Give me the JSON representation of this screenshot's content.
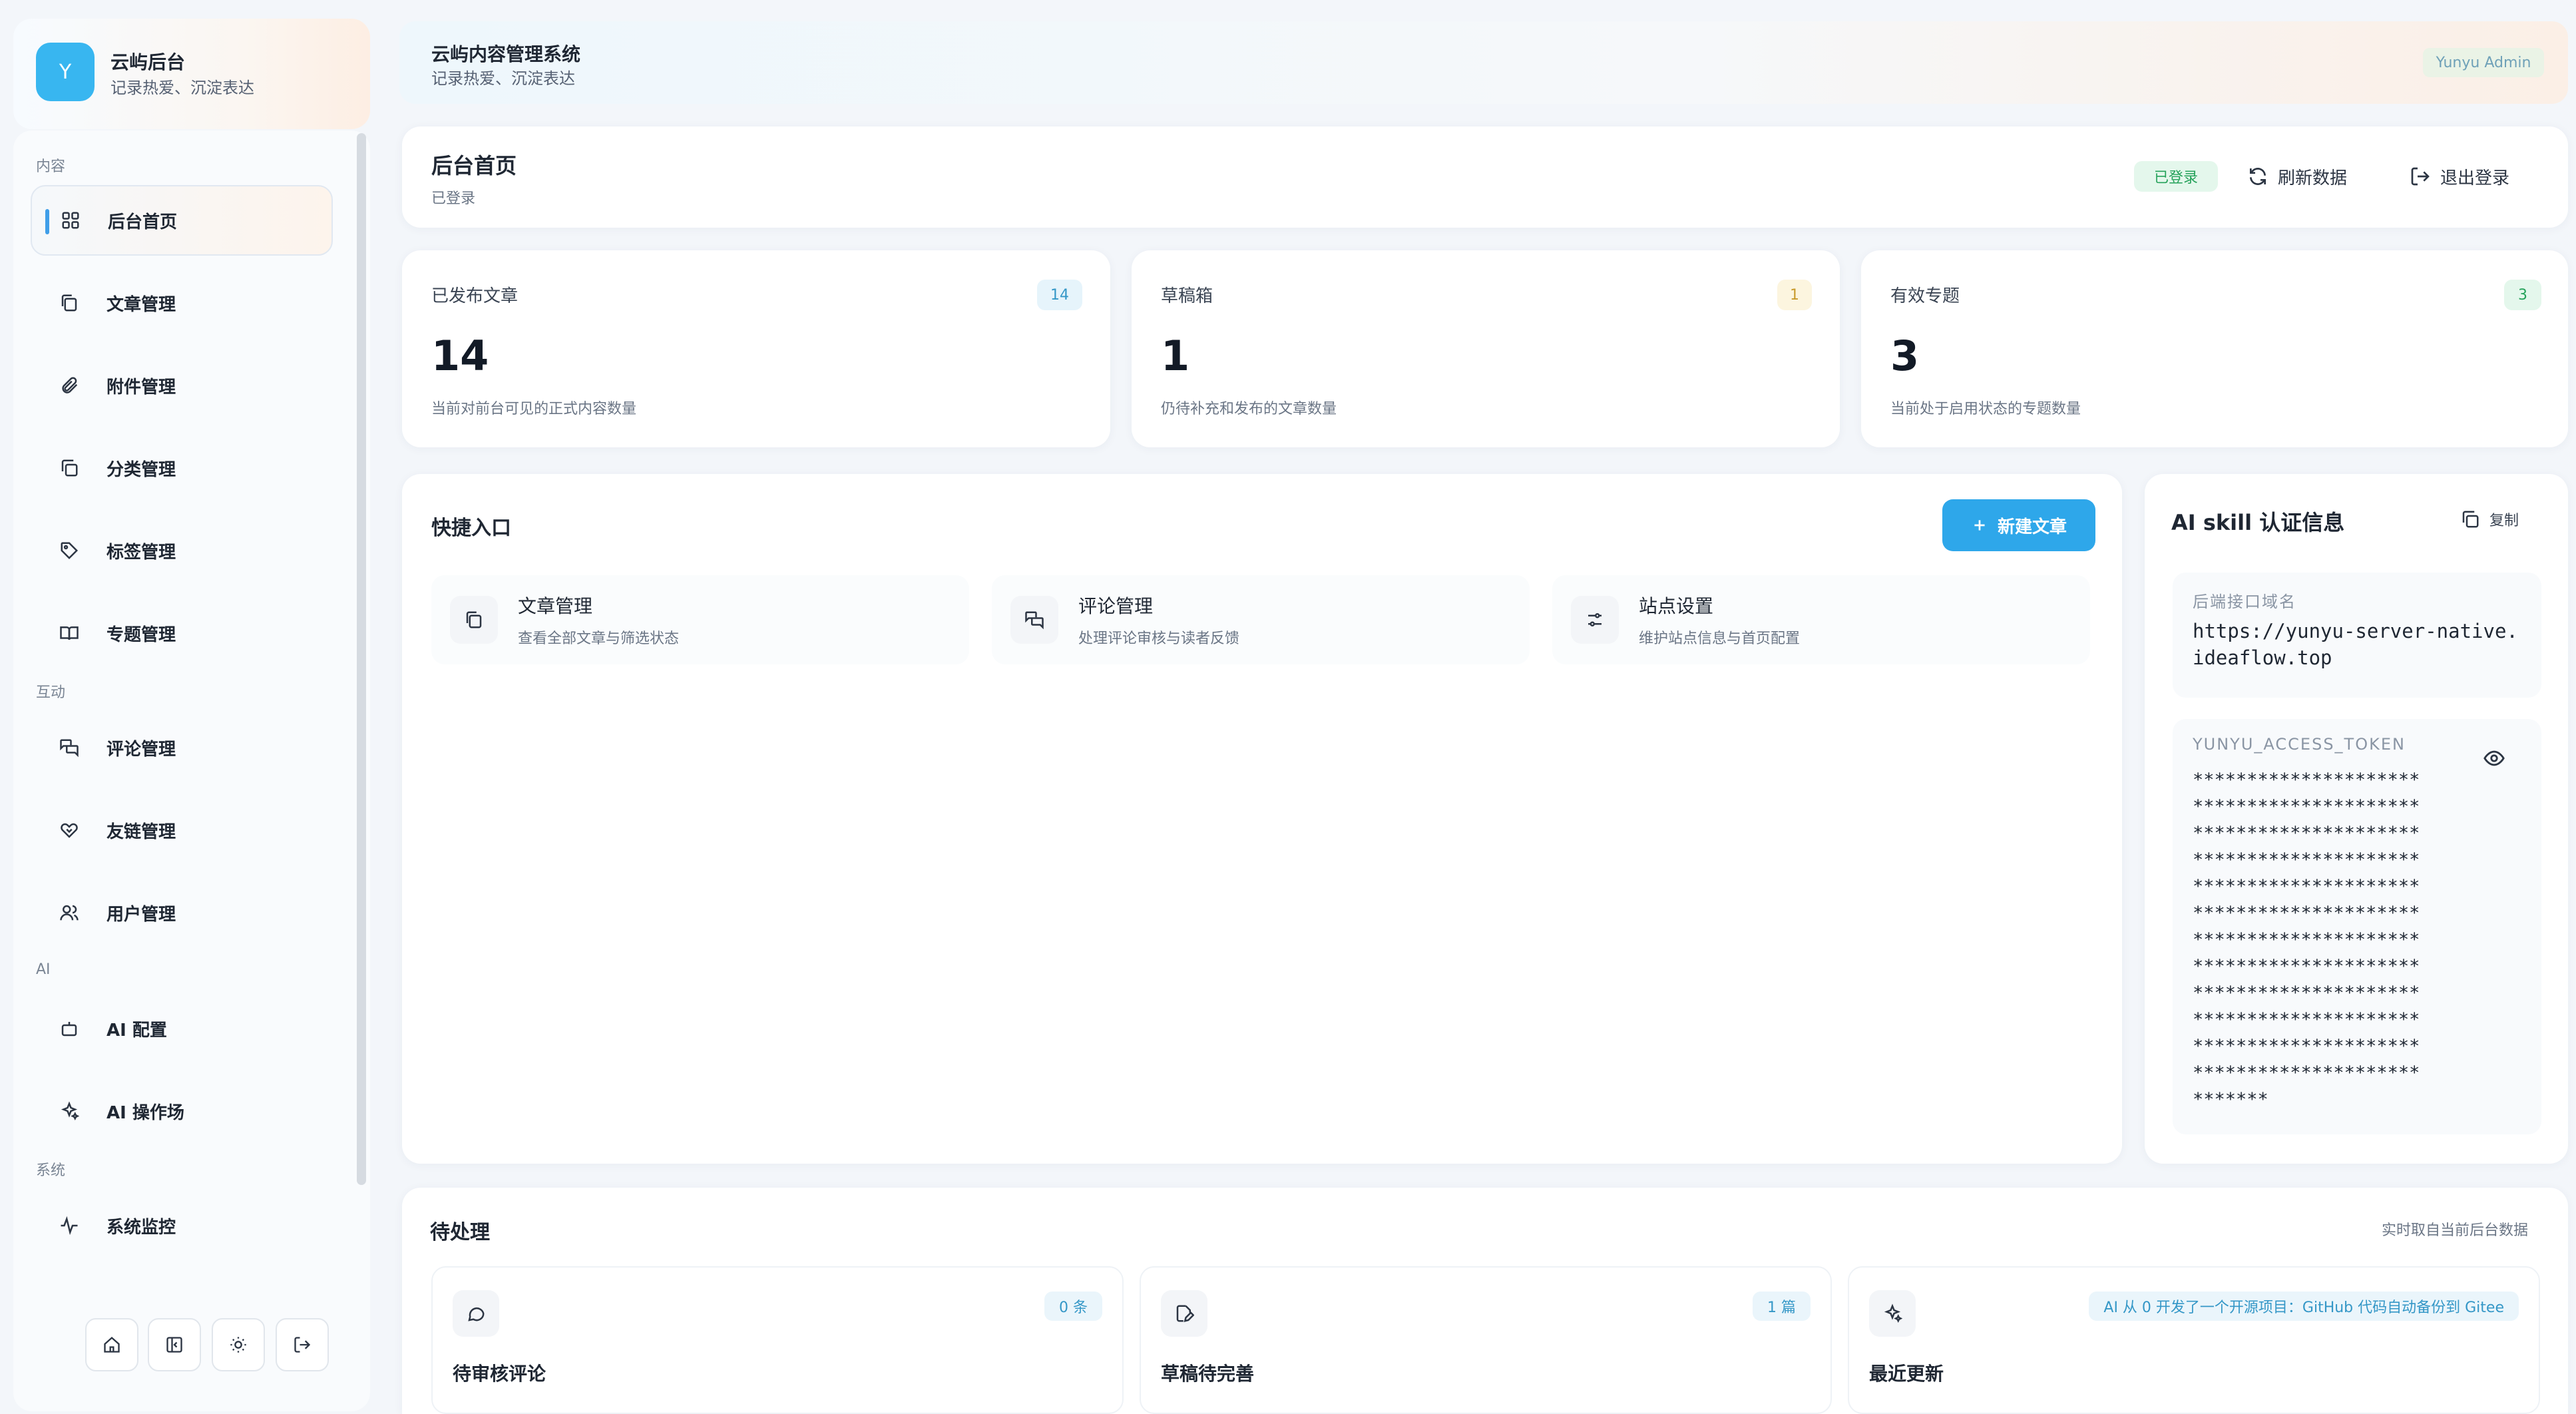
{
  "brand": {
    "avatar": "Y",
    "title": "云屿后台",
    "subtitle": "记录热爱、沉淀表达"
  },
  "sidebar": {
    "sections": [
      {
        "label": "内容"
      },
      {
        "label": "互动"
      },
      {
        "label": "AI"
      },
      {
        "label": "系统"
      }
    ],
    "items": [
      {
        "label": "后台首页",
        "icon": "dashboard-grid-icon",
        "active": true
      },
      {
        "label": "文章管理",
        "icon": "documents-icon"
      },
      {
        "label": "附件管理",
        "icon": "paperclip-icon"
      },
      {
        "label": "分类管理",
        "icon": "folders-icon"
      },
      {
        "label": "标签管理",
        "icon": "tag-icon"
      },
      {
        "label": "专题管理",
        "icon": "open-book-icon"
      },
      {
        "label": "评论管理",
        "icon": "chat-bubbles-icon"
      },
      {
        "label": "友链管理",
        "icon": "handshake-icon"
      },
      {
        "label": "用户管理",
        "icon": "users-icon"
      },
      {
        "label": "AI 配置",
        "icon": "robot-icon"
      },
      {
        "label": "AI 操作场",
        "icon": "sparkles-icon"
      },
      {
        "label": "系统监控",
        "icon": "pulse-icon"
      }
    ],
    "toolbar": [
      "home-icon",
      "sidebar-collapse-icon",
      "sun-icon",
      "logout-icon"
    ]
  },
  "header": {
    "title": "云屿内容管理系统",
    "subtitle": "记录热爱、沉淀表达",
    "admin_badge": "Yunyu Admin"
  },
  "page": {
    "title": "后台首页",
    "subtitle": "已登录",
    "status": "已登录",
    "refresh_label": "刷新数据",
    "logout_label": "退出登录"
  },
  "stats": [
    {
      "label": "已发布文章",
      "value": "14",
      "badge": "14",
      "desc": "当前对前台可见的正式内容数量",
      "badge_bg": "#e6f4fb",
      "badge_fg": "#3497c7"
    },
    {
      "label": "草稿箱",
      "value": "1",
      "badge": "1",
      "desc": "仍待补充和发布的文章数量",
      "badge_bg": "#fcf5df",
      "badge_fg": "#c89a2c"
    },
    {
      "label": "有效专题",
      "value": "3",
      "badge": "3",
      "desc": "当前处于启用状态的专题数量",
      "badge_bg": "#e4f7ec",
      "badge_fg": "#25a25a"
    }
  ],
  "quick": {
    "title": "快捷入口",
    "new_button": "新建文章",
    "items": [
      {
        "title": "文章管理",
        "desc": "查看全部文章与筛选状态",
        "icon": "documents-icon"
      },
      {
        "title": "评论管理",
        "desc": "处理评论审核与读者反馈",
        "icon": "chat-bubbles-icon"
      },
      {
        "title": "站点设置",
        "desc": "维护站点信息与首页配置",
        "icon": "sliders-icon"
      }
    ]
  },
  "ai_skill": {
    "title": "AI skill 认证信息",
    "copy_label": "复制",
    "domain_label": "后端接口域名",
    "domain_line1": "https://yunyu-server-native.",
    "domain_line2": "ideaflow.top",
    "token_label": "YUNYU_ACCESS_TOKEN",
    "token_lines": [
      "*********************",
      "*********************",
      "*********************",
      "*********************",
      "*********************",
      "*********************",
      "*********************",
      "*********************",
      "*********************",
      "*********************",
      "*********************",
      "*********************",
      "*******"
    ]
  },
  "pending": {
    "title": "待处理",
    "note": "实时取自当前后台数据",
    "items": [
      {
        "title": "待审核评论",
        "badge": "0 条",
        "icon": "comment-icon"
      },
      {
        "title": "草稿待完善",
        "badge": "1 篇",
        "icon": "edit-doc-icon"
      },
      {
        "title": "最近更新",
        "badge": "AI 从 0 开发了一个开源项目：GitHub 代码自动备份到 Gitee",
        "icon": "sparkles-icon"
      }
    ]
  },
  "colors": {
    "accent": "#2ea7ea",
    "success": "#25a25a",
    "warning": "#c89a2c"
  }
}
